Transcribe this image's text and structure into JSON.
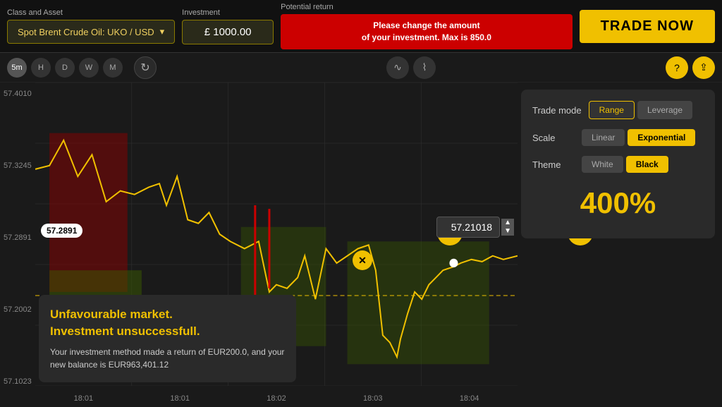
{
  "header": {
    "class_asset_label": "Class and Asset",
    "asset_name": "Spot Brent Crude Oil: UKO / USD",
    "investment_label": "Investment",
    "investment_value": "£ 1000.00",
    "potential_return_label": "Potential return",
    "error_message_line1": "Please change the amount",
    "error_message_line2": "of your investment. Max is 850.0",
    "trade_now_label": "TRADE NOW"
  },
  "toolbar": {
    "time_buttons": [
      "5m",
      "H",
      "D",
      "W",
      "M"
    ],
    "active_time": "5m",
    "refresh_icon": "↻",
    "chart_icon": "∿",
    "candle_icon": "⌇",
    "help_icon": "?",
    "share_icon": "⇪"
  },
  "chart": {
    "y_labels": [
      "57.4010",
      "57.3245",
      "57.2891",
      "57.2002",
      "57.1023"
    ],
    "x_labels": [
      "18:01",
      "18:01",
      "18:02",
      "18:03",
      "18:04"
    ],
    "current_price": "57.2891",
    "target_price": "57.21018"
  },
  "right_panel": {
    "trade_mode_label": "Trade mode",
    "range_label": "Range",
    "leverage_label": "Leverage",
    "active_trade_mode": "Range",
    "scale_label": "Scale",
    "linear_label": "Linear",
    "exponential_label": "Exponential",
    "active_scale": "Exponential",
    "theme_label": "Theme",
    "white_label": "White",
    "black_label": "Black",
    "active_theme": "Black",
    "percentage": "400%",
    "price_value": "57.21018",
    "up_arrow": "▲",
    "down_arrow": "▼",
    "arrow_left_icon": "↩",
    "arrow_right_icon": "↪"
  },
  "info_panel": {
    "title_line1": "Unfavourable market.",
    "title_line2": "Investment unsuccessfull.",
    "body": "Your investment method made a return of EUR200.0, and your new balance is EUR963,401.12",
    "close_icon": "✕"
  }
}
